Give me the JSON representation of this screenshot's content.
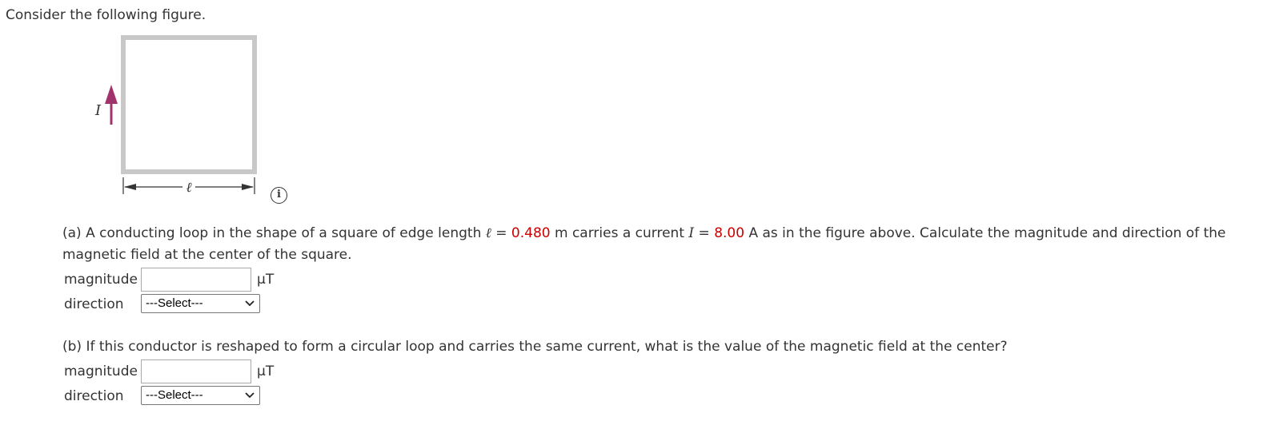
{
  "intro": "Consider the following figure.",
  "figure": {
    "current_label": "I",
    "length_label": "ℓ",
    "info_glyph": "i"
  },
  "colors": {
    "given_value": "#cc0000",
    "arrow": "#a0336b",
    "loop": "#c8c8c8"
  },
  "part_a": {
    "text_1": "(a) A conducting loop in the shape of a square of edge length ",
    "var_l": "ℓ",
    "eq_1": " = ",
    "l_value": "0.480",
    "text_2": " m carries a current ",
    "var_i": "I",
    "eq_2": " = ",
    "i_value": "8.00",
    "text_3": " A as in the figure above. Calculate the magnitude and direction of the magnetic field at the center of the square.",
    "magnitude_label": "magnitude",
    "magnitude_value": "",
    "unit": "μT",
    "direction_label": "direction",
    "direction_selected": "---Select---"
  },
  "part_b": {
    "text": "(b) If this conductor is reshaped to form a circular loop and carries the same current, what is the value of the magnetic field at the center?",
    "magnitude_label": "magnitude",
    "magnitude_value": "",
    "unit": "μT",
    "direction_label": "direction",
    "direction_selected": "---Select---"
  }
}
